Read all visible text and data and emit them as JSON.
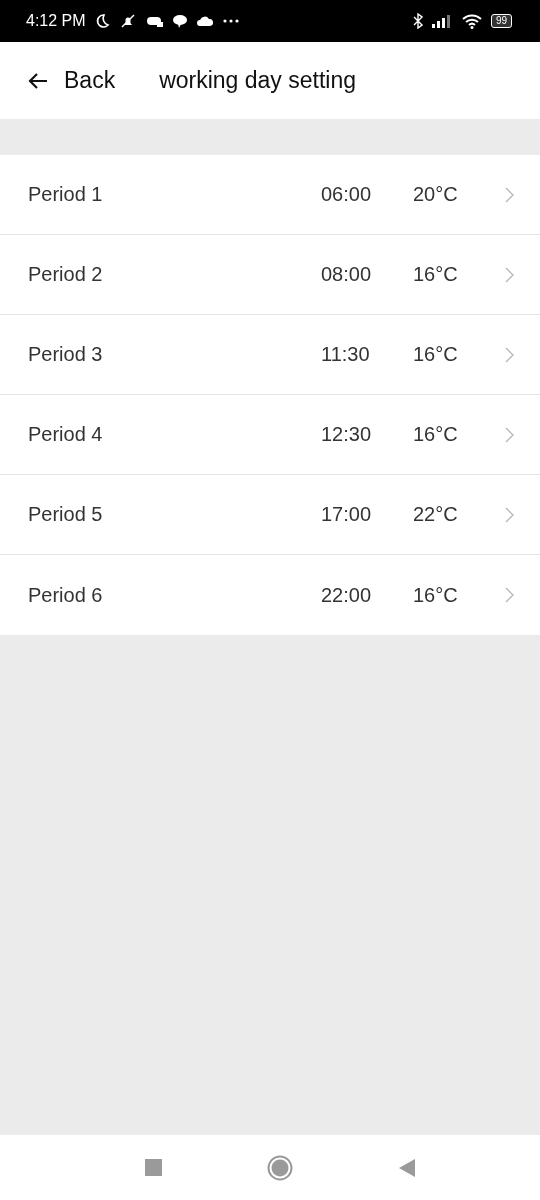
{
  "status_bar": {
    "time": "4:12 PM",
    "battery": "99"
  },
  "header": {
    "back": "Back",
    "title": "working day setting"
  },
  "periods": [
    {
      "name": "Period 1",
      "time": "06:00",
      "temp": "20°C"
    },
    {
      "name": "Period 2",
      "time": "08:00",
      "temp": "16°C"
    },
    {
      "name": "Period 3",
      "time": "11:30",
      "temp": "16°C"
    },
    {
      "name": "Period 4",
      "time": "12:30",
      "temp": "16°C"
    },
    {
      "name": "Period 5",
      "time": "17:00",
      "temp": "22°C"
    },
    {
      "name": "Period 6",
      "time": "22:00",
      "temp": "16°C"
    }
  ]
}
